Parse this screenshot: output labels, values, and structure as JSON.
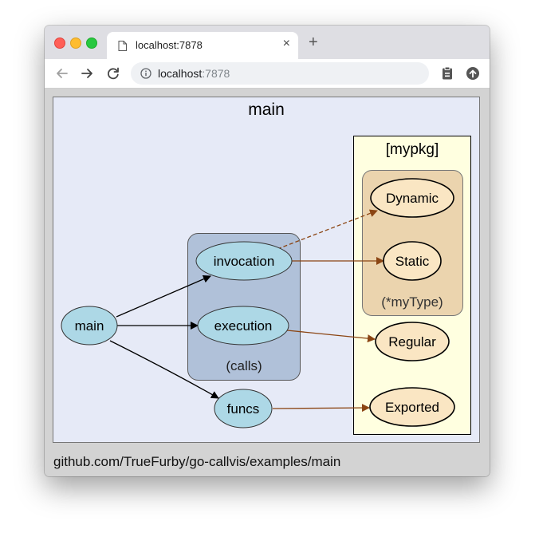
{
  "browser": {
    "tab_title": "localhost:7878",
    "tab_close_glyph": "×",
    "new_tab_glyph": "+",
    "url_host": "localhost",
    "url_port": ":7878",
    "icons": {
      "back": "arrow-left-icon",
      "forward": "arrow-right-icon",
      "reload": "reload-icon",
      "site_info": "info-icon",
      "clipboard": "clipboard-icon",
      "upload": "upload-icon",
      "document": "document-icon"
    }
  },
  "graph": {
    "title": "main",
    "clusters": {
      "pkg": "[mypkg]",
      "type": "(*myType)",
      "calls": "(calls)"
    },
    "nodes": {
      "main": "main",
      "invocation": "invocation",
      "execution": "execution",
      "funcs": "funcs",
      "dynamic": "Dynamic",
      "static": "Static",
      "regular": "Regular",
      "exported": "Exported"
    },
    "colors": {
      "background": "#e6eaf7",
      "calls_cluster": "#b0c1d9",
      "pkg_cluster": "#ffffe0",
      "type_cluster": "#ebd4ae",
      "local_node": "#add8e6",
      "pkg_node": "#fae6c3",
      "internal_edge": "#000000",
      "external_edge": "#8b4513"
    }
  },
  "footer": {
    "path": "github.com/TrueFurby/go-callvis/examples/main"
  }
}
